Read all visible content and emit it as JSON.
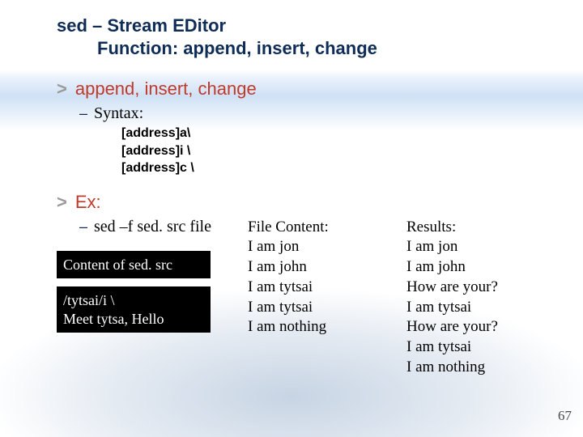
{
  "title": {
    "line1": "sed – Stream EDitor",
    "line2": "Function: append, insert, change"
  },
  "section1": {
    "heading": "append, insert, change",
    "sub": "Syntax:",
    "syntax": "[address]a\\\n[address]i \\\n[address]c \\"
  },
  "section2": {
    "heading": "Ex:",
    "sub": "sed –f sed. src file",
    "box1": "Content of sed. src",
    "box2": "/tytsai/i \\\nMeet tytsa, Hello"
  },
  "fileContent": "File Content:\nI am jon\nI am john\nI am tytsai\nI am tytsai\nI am nothing",
  "results": "Results:\nI am jon\nI am john\nHow are your?\nI am tytsai\nHow are your?\nI am tytsai\nI am nothing",
  "pageNumber": "67"
}
